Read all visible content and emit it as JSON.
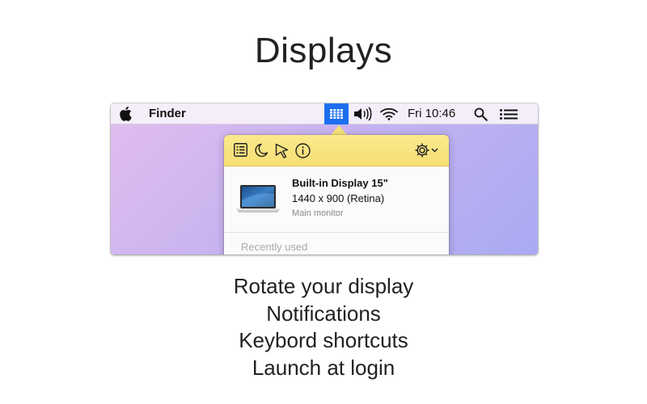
{
  "hero": {
    "title": "Displays"
  },
  "menubar": {
    "app_name": "Finder",
    "clock": "Fri 10:46",
    "icons": [
      "apple-icon",
      "displays-grid-icon",
      "volume-icon",
      "wifi-icon",
      "search-icon",
      "notification-list-icon"
    ],
    "active_color": "#1d6ff0"
  },
  "popover": {
    "toolbar_icons": [
      "list-icon",
      "moon-icon",
      "cursor-icon",
      "info-icon",
      "gear-icon",
      "chevron-down-icon"
    ],
    "toolbar_color": "#f6df73",
    "display": {
      "name": "Built-in Display 15\"",
      "resolution": "1440 x 900 (Retina)",
      "subtitle": "Main monitor"
    },
    "section_label": "Recently used"
  },
  "features": [
    "Rotate your display",
    "Notifications",
    "Keybord shortcuts",
    "Launch at login"
  ]
}
